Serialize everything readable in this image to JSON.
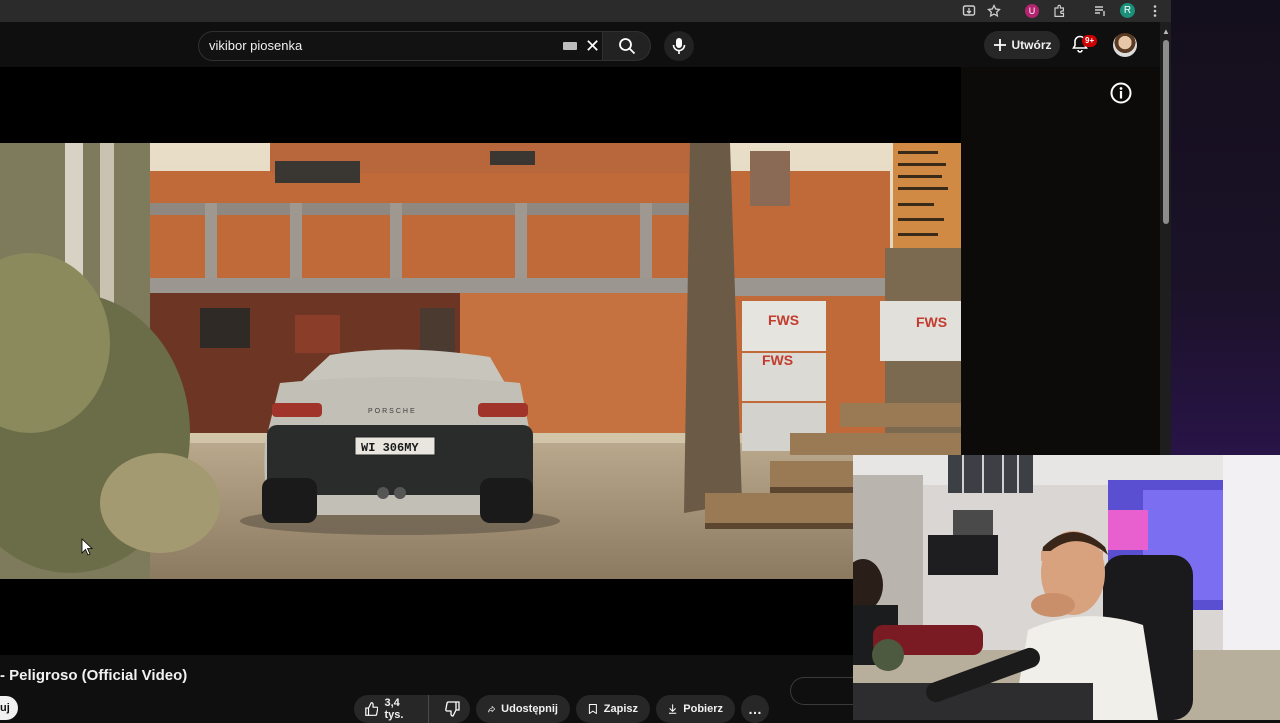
{
  "browser": {
    "extension_profile_letter": "R",
    "extension_ublock_letter": "U",
    "icons": [
      "install-icon",
      "bookmark-star-icon",
      "ublock-icon",
      "extensions-puzzle-icon",
      "media-queue-icon",
      "profile-icon",
      "kebab-menu-icon"
    ]
  },
  "header": {
    "search_value": "vikibor piosenka",
    "create_label": "Utwórz",
    "notifications_badge": "9+"
  },
  "video": {
    "title": "- Peligroso (Official Video)",
    "plate_text": "WI 306MY",
    "car_badge": "PORSCHE",
    "pallet_brand": "FWS"
  },
  "actions": {
    "subscribe_partial": "uj",
    "likes": "3,4 tys.",
    "share_label": "Udostępnij",
    "save_label": "Zapisz",
    "download_label": "Pobierz",
    "more_label": "…"
  },
  "colors": {
    "background": "#0f0f0f",
    "pill": "#272727",
    "badge_red": "#cc0000",
    "desktop_purple": "#3a1a66"
  }
}
